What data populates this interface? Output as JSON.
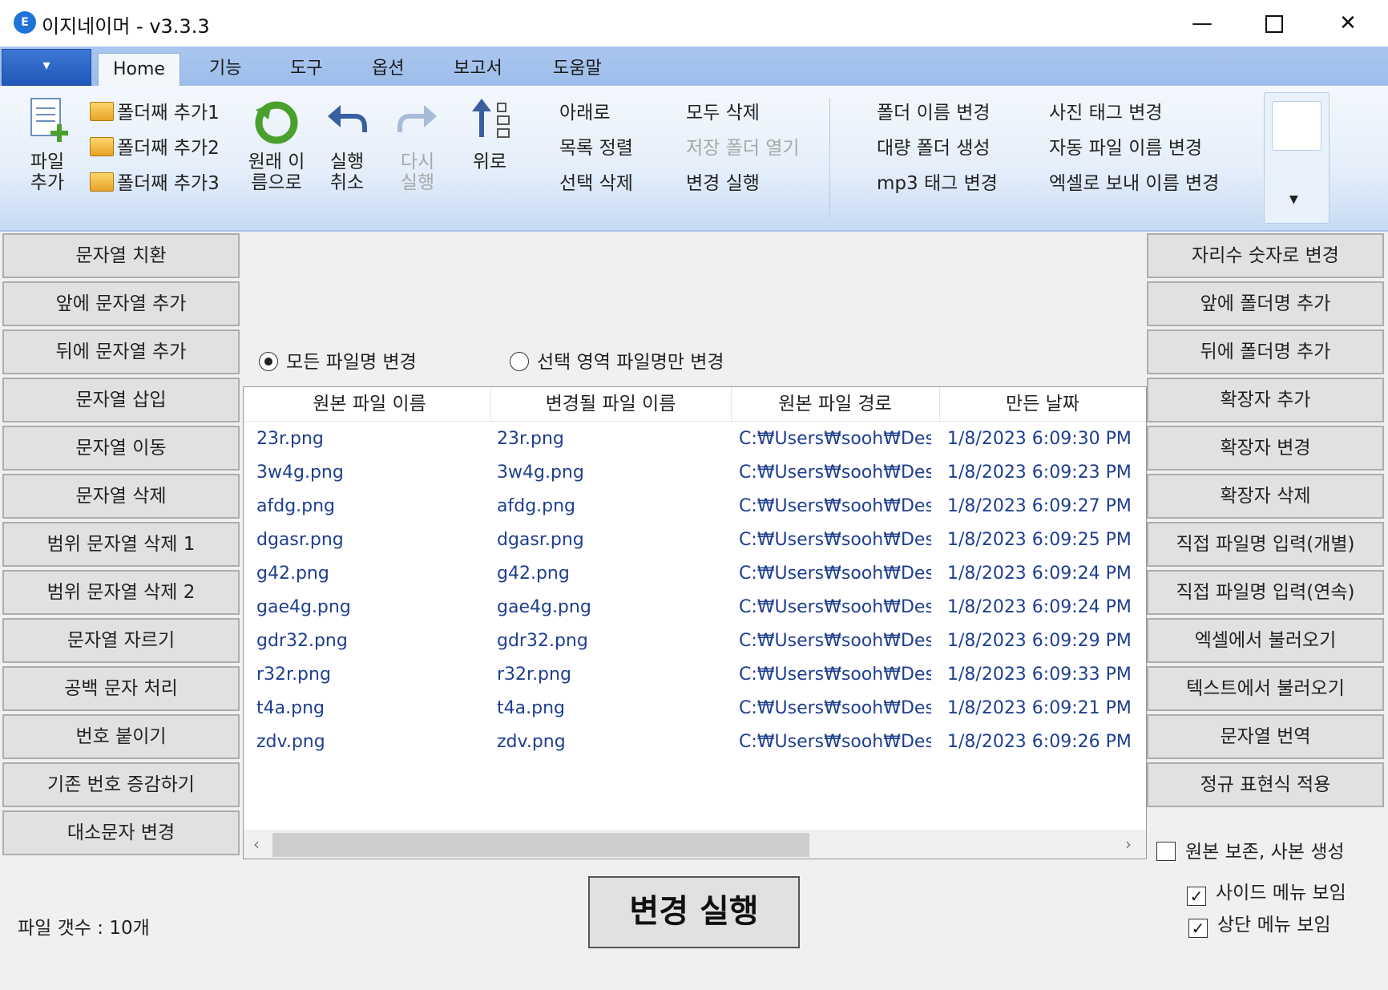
{
  "window": {
    "title": "이지네이머 - v3.3.3"
  },
  "tabs": [
    "Home",
    "기능",
    "도구",
    "옵션",
    "보고서",
    "도움말"
  ],
  "ribbon": {
    "add_file": "파일\n추가",
    "add_folder": [
      "폴더째 추가1",
      "폴더째 추가2",
      "폴더째 추가3"
    ],
    "restore": "원래 이\n름으로",
    "undo": "실행\n취소",
    "redo": "다시\n실행",
    "up": "위로",
    "col1": [
      "아래로",
      "목록 정렬",
      "선택 삭제"
    ],
    "col2": [
      "모두 삭제",
      "저장 폴더 열기",
      "변경 실행"
    ],
    "col3": [
      "폴더 이름 변경",
      "대량 폴더 생성",
      "mp3 태그 변경"
    ],
    "col4": [
      "사진 태그 변경",
      "자동 파일 이름 변경",
      "엑셀로 보내 이름 변경"
    ]
  },
  "left_menu": [
    "문자열 치환",
    "앞에 문자열 추가",
    "뒤에 문자열 추가",
    "문자열 삽입",
    "문자열 이동",
    "문자열 삭제",
    "범위 문자열 삭제 1",
    "범위 문자열 삭제 2",
    "문자열 자르기",
    "공백 문자 처리",
    "번호 붙이기",
    "기존 번호 증감하기",
    "대소문자 변경"
  ],
  "right_menu": [
    "자리수 숫자로 변경",
    "앞에 폴더명 추가",
    "뒤에 폴더명 추가",
    "확장자 추가",
    "확장자 변경",
    "확장자 삭제",
    "직접 파일명 입력(개별)",
    "직접 파일명 입력(연속)",
    "엑셀에서 불러오기",
    "텍스트에서 불러오기",
    "문자열 번역",
    "정규 표현식 적용"
  ],
  "scope": {
    "all": "모든 파일명 변경",
    "selected": "선택 영역 파일명만 변경",
    "checked": "all"
  },
  "table": {
    "columns": [
      "원본 파일 이름",
      "변경될 파일 이름",
      "원본 파일 경로",
      "만든 날짜"
    ],
    "rows": [
      [
        "23r.png",
        "23r.png",
        "C:₩Users₩sooh₩Desk",
        "1/8/2023 6:09:30 PM"
      ],
      [
        "3w4g.png",
        "3w4g.png",
        "C:₩Users₩sooh₩Desk",
        "1/8/2023 6:09:23 PM"
      ],
      [
        "afdg.png",
        "afdg.png",
        "C:₩Users₩sooh₩Desk",
        "1/8/2023 6:09:27 PM"
      ],
      [
        "dgasr.png",
        "dgasr.png",
        "C:₩Users₩sooh₩Desk",
        "1/8/2023 6:09:25 PM"
      ],
      [
        "g42.png",
        "g42.png",
        "C:₩Users₩sooh₩Desk",
        "1/8/2023 6:09:24 PM"
      ],
      [
        "gae4g.png",
        "gae4g.png",
        "C:₩Users₩sooh₩Desk",
        "1/8/2023 6:09:24 PM"
      ],
      [
        "gdr32.png",
        "gdr32.png",
        "C:₩Users₩sooh₩Desk",
        "1/8/2023 6:09:29 PM"
      ],
      [
        "r32r.png",
        "r32r.png",
        "C:₩Users₩sooh₩Desk",
        "1/8/2023 6:09:33 PM"
      ],
      [
        "t4a.png",
        "t4a.png",
        "C:₩Users₩sooh₩Desk",
        "1/8/2023 6:09:21 PM"
      ],
      [
        "zdv.png",
        "zdv.png",
        "C:₩Users₩sooh₩Desk",
        "1/8/2023 6:09:26 PM"
      ]
    ]
  },
  "options": {
    "keep_original": {
      "label": "원본 보존, 사본 생성",
      "checked": false
    },
    "show_side_menu": {
      "label": "사이드 메뉴 보임",
      "checked": true
    },
    "show_top_menu": {
      "label": "상단 메뉴 보임",
      "checked": true
    }
  },
  "execute_button": "변경 실행",
  "status": {
    "file_count": "파일 갯수 : 10개"
  },
  "colors": {
    "ribbon_blue": "#9dbdea",
    "list_text": "#1f3f8f"
  }
}
